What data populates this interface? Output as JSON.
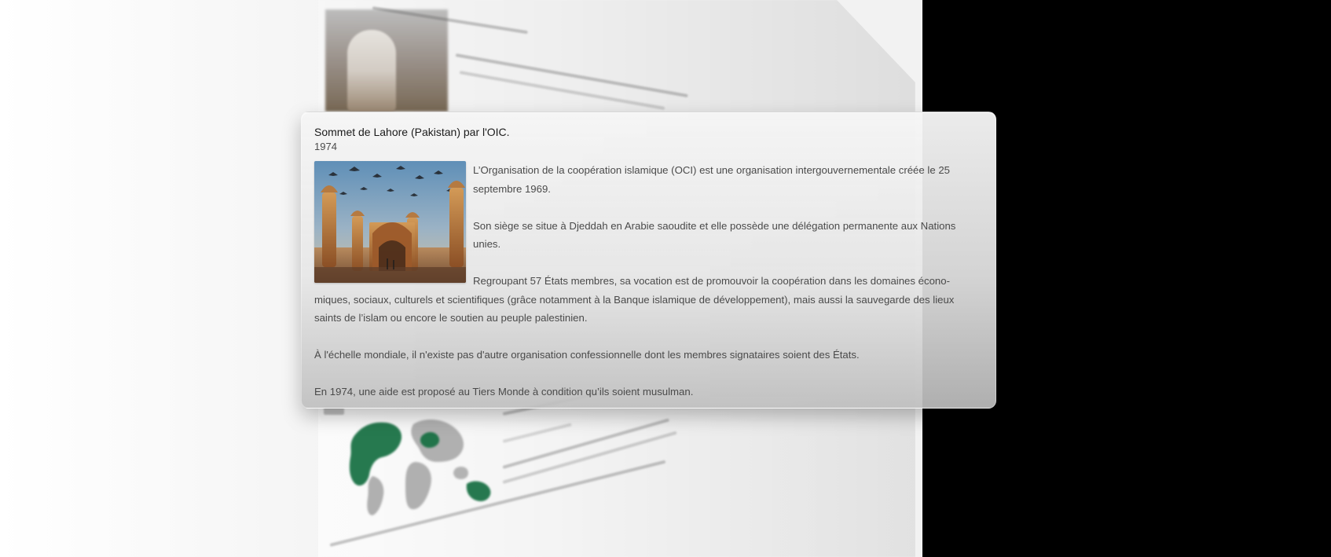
{
  "popup": {
    "title": "Sommet de Lahore (Pakistan) par l'OIC.",
    "year": "1974",
    "photo": {
      "icon": "mosque-photo-icon",
      "sky_color": "#7ea1c0",
      "building_color": "#b8743d"
    },
    "paragraphs": [
      "L’Organisation de la coopération islamique (OCI) est une organisation intergouvernementale créée le 25 septembre 1969.",
      "Son siège se situe à Djeddah en Arabie saoudite et elle possède une délégation permanente aux Nations unies.",
      "Regroupant 57 États membres, sa vocation est de promouvoir la coopération dans les domaines écono-miques, sociaux, culturels et scientifiques (grâce notamment à la Banque islamique de développement), mais aussi la sauvegarde des lieux saints de l’islam ou encore le soutien au peuple palestinien.",
      "À l'échelle mondiale, il n'existe pas d'autre organisation confessionnelle dont les membres signataires soient des États.",
      "En 1974, une aide est proposé au Tiers Monde à condition qu’ils soient musulman."
    ]
  },
  "background": {
    "map_icon": "world-map-icon",
    "highlight_color": "#0f6a3c",
    "black_color": "#000000"
  }
}
